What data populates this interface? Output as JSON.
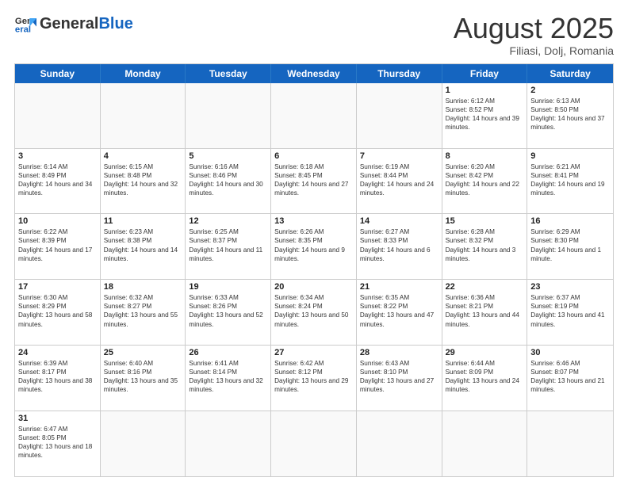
{
  "header": {
    "logo_general": "General",
    "logo_blue": "Blue",
    "month_title": "August 2025",
    "subtitle": "Filiasi, Dolj, Romania"
  },
  "weekdays": [
    "Sunday",
    "Monday",
    "Tuesday",
    "Wednesday",
    "Thursday",
    "Friday",
    "Saturday"
  ],
  "rows": [
    [
      {
        "day": "",
        "info": ""
      },
      {
        "day": "",
        "info": ""
      },
      {
        "day": "",
        "info": ""
      },
      {
        "day": "",
        "info": ""
      },
      {
        "day": "",
        "info": ""
      },
      {
        "day": "1",
        "info": "Sunrise: 6:12 AM\nSunset: 8:52 PM\nDaylight: 14 hours and 39 minutes."
      },
      {
        "day": "2",
        "info": "Sunrise: 6:13 AM\nSunset: 8:50 PM\nDaylight: 14 hours and 37 minutes."
      }
    ],
    [
      {
        "day": "3",
        "info": "Sunrise: 6:14 AM\nSunset: 8:49 PM\nDaylight: 14 hours and 34 minutes."
      },
      {
        "day": "4",
        "info": "Sunrise: 6:15 AM\nSunset: 8:48 PM\nDaylight: 14 hours and 32 minutes."
      },
      {
        "day": "5",
        "info": "Sunrise: 6:16 AM\nSunset: 8:46 PM\nDaylight: 14 hours and 30 minutes."
      },
      {
        "day": "6",
        "info": "Sunrise: 6:18 AM\nSunset: 8:45 PM\nDaylight: 14 hours and 27 minutes."
      },
      {
        "day": "7",
        "info": "Sunrise: 6:19 AM\nSunset: 8:44 PM\nDaylight: 14 hours and 24 minutes."
      },
      {
        "day": "8",
        "info": "Sunrise: 6:20 AM\nSunset: 8:42 PM\nDaylight: 14 hours and 22 minutes."
      },
      {
        "day": "9",
        "info": "Sunrise: 6:21 AM\nSunset: 8:41 PM\nDaylight: 14 hours and 19 minutes."
      }
    ],
    [
      {
        "day": "10",
        "info": "Sunrise: 6:22 AM\nSunset: 8:39 PM\nDaylight: 14 hours and 17 minutes."
      },
      {
        "day": "11",
        "info": "Sunrise: 6:23 AM\nSunset: 8:38 PM\nDaylight: 14 hours and 14 minutes."
      },
      {
        "day": "12",
        "info": "Sunrise: 6:25 AM\nSunset: 8:37 PM\nDaylight: 14 hours and 11 minutes."
      },
      {
        "day": "13",
        "info": "Sunrise: 6:26 AM\nSunset: 8:35 PM\nDaylight: 14 hours and 9 minutes."
      },
      {
        "day": "14",
        "info": "Sunrise: 6:27 AM\nSunset: 8:33 PM\nDaylight: 14 hours and 6 minutes."
      },
      {
        "day": "15",
        "info": "Sunrise: 6:28 AM\nSunset: 8:32 PM\nDaylight: 14 hours and 3 minutes."
      },
      {
        "day": "16",
        "info": "Sunrise: 6:29 AM\nSunset: 8:30 PM\nDaylight: 14 hours and 1 minute."
      }
    ],
    [
      {
        "day": "17",
        "info": "Sunrise: 6:30 AM\nSunset: 8:29 PM\nDaylight: 13 hours and 58 minutes."
      },
      {
        "day": "18",
        "info": "Sunrise: 6:32 AM\nSunset: 8:27 PM\nDaylight: 13 hours and 55 minutes."
      },
      {
        "day": "19",
        "info": "Sunrise: 6:33 AM\nSunset: 8:26 PM\nDaylight: 13 hours and 52 minutes."
      },
      {
        "day": "20",
        "info": "Sunrise: 6:34 AM\nSunset: 8:24 PM\nDaylight: 13 hours and 50 minutes."
      },
      {
        "day": "21",
        "info": "Sunrise: 6:35 AM\nSunset: 8:22 PM\nDaylight: 13 hours and 47 minutes."
      },
      {
        "day": "22",
        "info": "Sunrise: 6:36 AM\nSunset: 8:21 PM\nDaylight: 13 hours and 44 minutes."
      },
      {
        "day": "23",
        "info": "Sunrise: 6:37 AM\nSunset: 8:19 PM\nDaylight: 13 hours and 41 minutes."
      }
    ],
    [
      {
        "day": "24",
        "info": "Sunrise: 6:39 AM\nSunset: 8:17 PM\nDaylight: 13 hours and 38 minutes."
      },
      {
        "day": "25",
        "info": "Sunrise: 6:40 AM\nSunset: 8:16 PM\nDaylight: 13 hours and 35 minutes."
      },
      {
        "day": "26",
        "info": "Sunrise: 6:41 AM\nSunset: 8:14 PM\nDaylight: 13 hours and 32 minutes."
      },
      {
        "day": "27",
        "info": "Sunrise: 6:42 AM\nSunset: 8:12 PM\nDaylight: 13 hours and 29 minutes."
      },
      {
        "day": "28",
        "info": "Sunrise: 6:43 AM\nSunset: 8:10 PM\nDaylight: 13 hours and 27 minutes."
      },
      {
        "day": "29",
        "info": "Sunrise: 6:44 AM\nSunset: 8:09 PM\nDaylight: 13 hours and 24 minutes."
      },
      {
        "day": "30",
        "info": "Sunrise: 6:46 AM\nSunset: 8:07 PM\nDaylight: 13 hours and 21 minutes."
      }
    ],
    [
      {
        "day": "31",
        "info": "Sunrise: 6:47 AM\nSunset: 8:05 PM\nDaylight: 13 hours and 18 minutes."
      },
      {
        "day": "",
        "info": ""
      },
      {
        "day": "",
        "info": ""
      },
      {
        "day": "",
        "info": ""
      },
      {
        "day": "",
        "info": ""
      },
      {
        "day": "",
        "info": ""
      },
      {
        "day": "",
        "info": ""
      }
    ]
  ]
}
